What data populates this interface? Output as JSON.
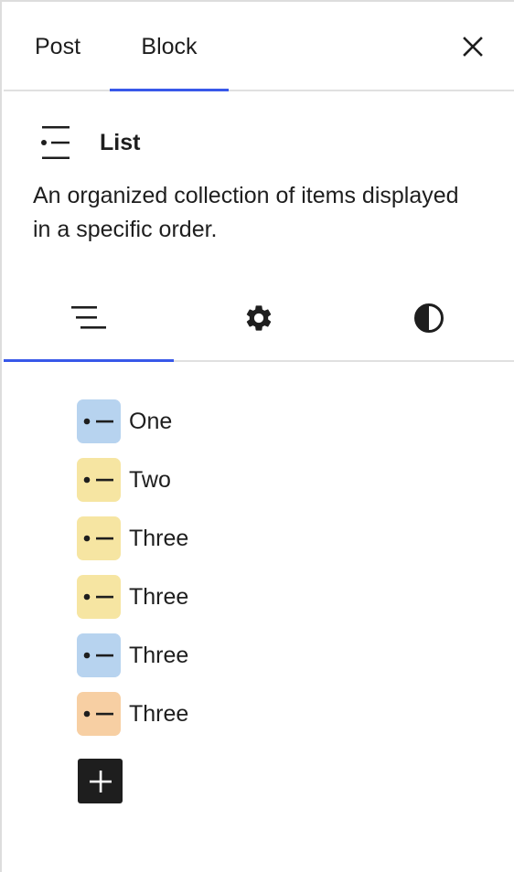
{
  "header": {
    "tabs": [
      {
        "label": "Post",
        "active": false
      },
      {
        "label": "Block",
        "active": true
      }
    ],
    "close_icon": "close-icon"
  },
  "block_card": {
    "icon": "list-icon",
    "title": "List",
    "description": "An organized collection of items displayed in a specific order."
  },
  "inspector_tabs": [
    {
      "icon": "list-view-icon",
      "active": true
    },
    {
      "icon": "settings-gear-icon",
      "active": false
    },
    {
      "icon": "styles-contrast-icon",
      "active": false
    }
  ],
  "list_view": {
    "items": [
      {
        "label": "One",
        "icon_color": "#b7d3ef"
      },
      {
        "label": "Two",
        "icon_color": "#f6e5a2"
      },
      {
        "label": "Three",
        "icon_color": "#f6e5a2"
      },
      {
        "label": "Three",
        "icon_color": "#f6e5a2"
      },
      {
        "label": "Three",
        "icon_color": "#b7d3ef"
      },
      {
        "label": "Three",
        "icon_color": "#f7cfa3"
      }
    ],
    "add_icon": "plus-icon"
  },
  "colors": {
    "accent": "#3858e9",
    "text": "#1e1e1e",
    "divider": "#e0e0e0"
  }
}
